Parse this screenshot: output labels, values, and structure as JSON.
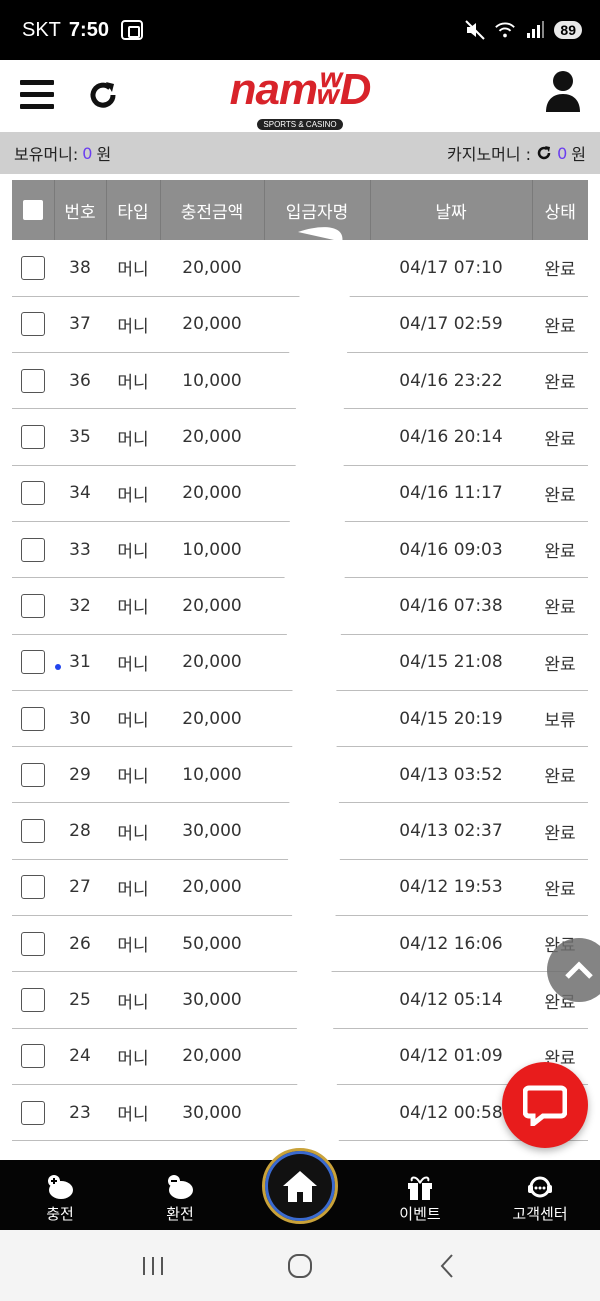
{
  "status_bar": {
    "carrier": "SKT",
    "time": "7:50",
    "battery": "89"
  },
  "header": {
    "logo_text": "namʬD",
    "logo_sub": "SPORTS & CASINO"
  },
  "balance": {
    "money_label": "보유머니:",
    "money_value": "0",
    "money_unit": "원",
    "casino_label": "카지노머니 :",
    "casino_value": "0",
    "casino_unit": "원"
  },
  "table": {
    "headers": [
      "번호",
      "타입",
      "충전금액",
      "입금자명",
      "날짜",
      "상태"
    ],
    "rows": [
      {
        "num": "38",
        "type": "머니",
        "amount": "20,000",
        "date": "04/17 07:10",
        "status": "완료"
      },
      {
        "num": "37",
        "type": "머니",
        "amount": "20,000",
        "date": "04/17 02:59",
        "status": "완료"
      },
      {
        "num": "36",
        "type": "머니",
        "amount": "10,000",
        "date": "04/16 23:22",
        "status": "완료"
      },
      {
        "num": "35",
        "type": "머니",
        "amount": "20,000",
        "date": "04/16 20:14",
        "status": "완료"
      },
      {
        "num": "34",
        "type": "머니",
        "amount": "20,000",
        "date": "04/16 11:17",
        "status": "완료"
      },
      {
        "num": "33",
        "type": "머니",
        "amount": "10,000",
        "date": "04/16 09:03",
        "status": "완료"
      },
      {
        "num": "32",
        "type": "머니",
        "amount": "20,000",
        "date": "04/16 07:38",
        "status": "완료"
      },
      {
        "num": "31",
        "type": "머니",
        "amount": "20,000",
        "date": "04/15 21:08",
        "status": "완료"
      },
      {
        "num": "30",
        "type": "머니",
        "amount": "20,000",
        "date": "04/15 20:19",
        "status": "보류"
      },
      {
        "num": "29",
        "type": "머니",
        "amount": "10,000",
        "date": "04/13 03:52",
        "status": "완료"
      },
      {
        "num": "28",
        "type": "머니",
        "amount": "30,000",
        "date": "04/13 02:37",
        "status": "완료"
      },
      {
        "num": "27",
        "type": "머니",
        "amount": "20,000",
        "date": "04/12 19:53",
        "status": "완료"
      },
      {
        "num": "26",
        "type": "머니",
        "amount": "50,000",
        "date": "04/12 16:06",
        "status": "완료"
      },
      {
        "num": "25",
        "type": "머니",
        "amount": "30,000",
        "date": "04/12 05:14",
        "status": "완료"
      },
      {
        "num": "24",
        "type": "머니",
        "amount": "20,000",
        "date": "04/12 01:09",
        "status": "완료"
      },
      {
        "num": "23",
        "type": "머니",
        "amount": "30,000",
        "date": "04/12 00:58",
        "status": ""
      }
    ]
  },
  "bottom_nav": {
    "deposit": "충전",
    "withdraw": "환전",
    "event": "이벤트",
    "support": "고객센터"
  },
  "colors": {
    "brand_red": "#d8232a",
    "accent_purple": "#6a3df0",
    "header_gray": "#8e8e8e"
  }
}
